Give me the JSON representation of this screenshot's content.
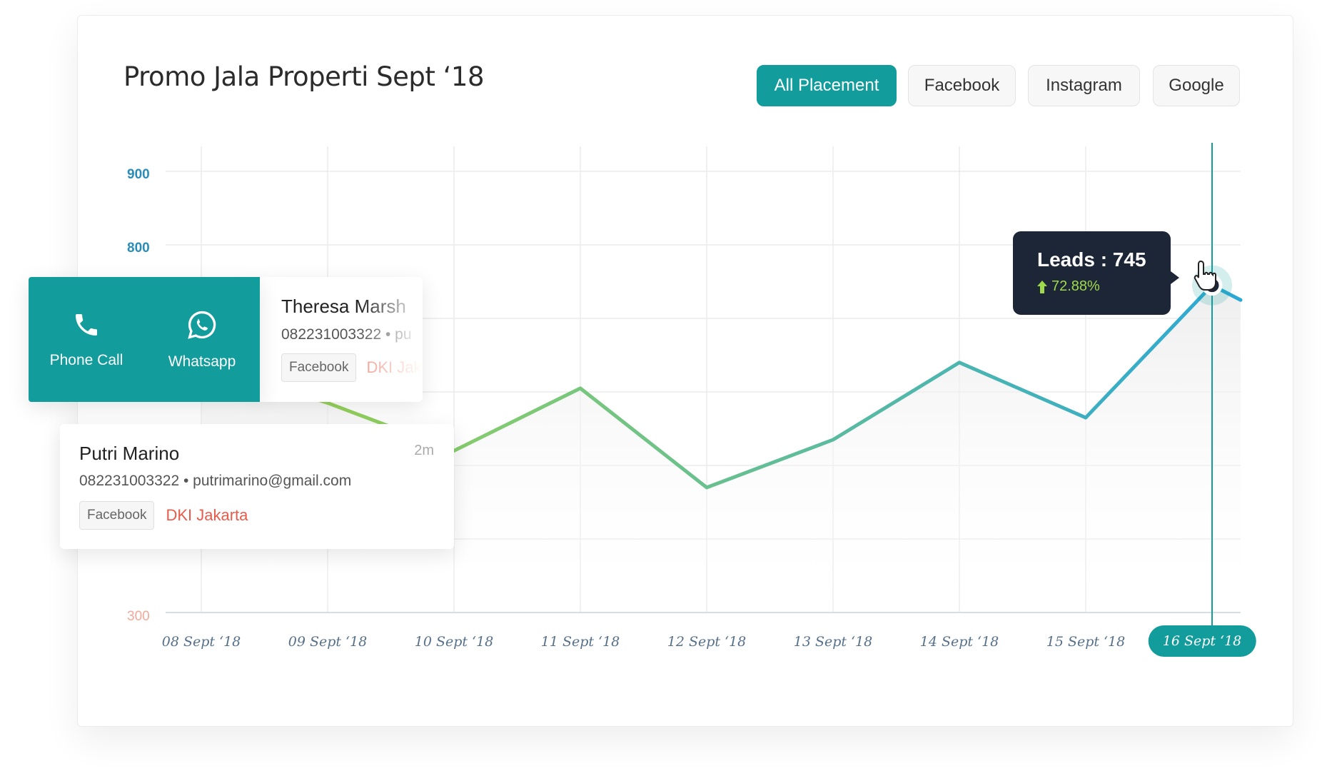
{
  "title": "Promo Jala Properti Sept ‘18",
  "tabs": [
    {
      "label": "All Placement",
      "active": true
    },
    {
      "label": "Facebook",
      "active": false
    },
    {
      "label": "Instagram",
      "active": false
    },
    {
      "label": "Google",
      "active": false
    }
  ],
  "colors": {
    "accent": "#139c9c",
    "line_start": "#a4d84a",
    "line_end": "#2ba8d6",
    "tooltip_bg": "#1d2636"
  },
  "chart_data": {
    "type": "line",
    "title": "Promo Jala Properti Sept ‘18",
    "categories": [
      "08 Sept ‘18",
      "09 Sept ‘18",
      "10 Sept ‘18",
      "11 Sept ‘18",
      "12 Sept ‘18",
      "13 Sept ‘18",
      "14 Sept ‘18",
      "15 Sept ‘18",
      "16 Sept ‘18"
    ],
    "values": [
      640,
      585,
      520,
      605,
      470,
      535,
      640,
      565,
      745
    ],
    "tail_value": 725,
    "y_ticks": [
      900,
      800,
      300
    ],
    "ylim": [
      300,
      900
    ],
    "grid": true,
    "selected_index": 8,
    "tooltip": {
      "label": "Leads : 745",
      "change": "72.88%",
      "direction": "up"
    }
  },
  "contact_actions": [
    {
      "label": "Phone Call",
      "icon": "phone-icon"
    },
    {
      "label": "Whatsapp",
      "icon": "whatsapp-icon"
    }
  ],
  "leads": [
    {
      "name": "Theresa Marsh",
      "meta": "082231003322 • pu",
      "source": "Facebook",
      "location": "DKI Jak"
    },
    {
      "name": "Putri Marino",
      "time": "2m",
      "meta": "082231003322 • putrimarino@gmail.com",
      "source": "Facebook",
      "location": "DKI Jakarta"
    }
  ]
}
